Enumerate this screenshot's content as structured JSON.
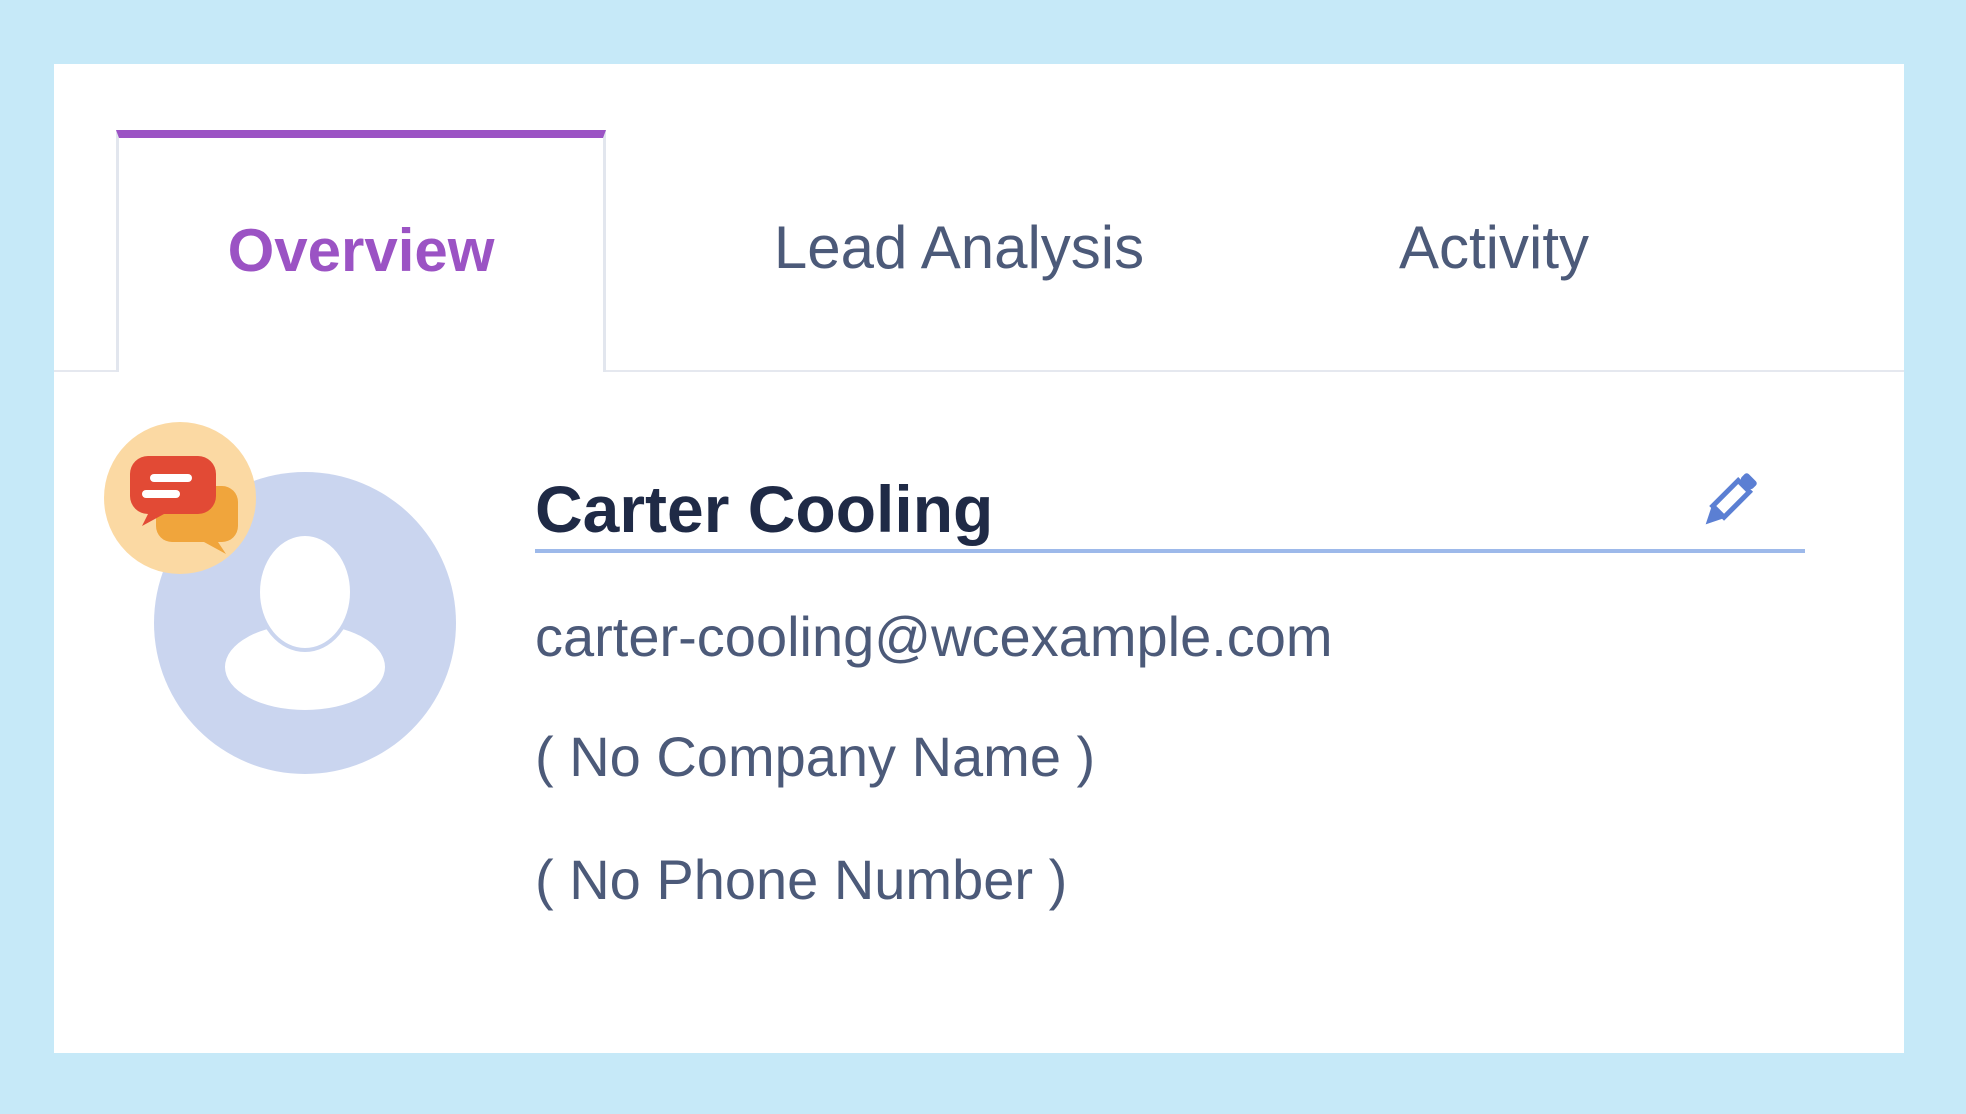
{
  "tabs": [
    {
      "label": "Overview",
      "active": true
    },
    {
      "label": "Lead Analysis",
      "active": false
    },
    {
      "label": "Activity",
      "active": false
    }
  ],
  "contact": {
    "name": "Carter Cooling",
    "email": "carter-cooling@wcexample.com",
    "company": "( No Company Name )",
    "phone": "( No Phone Number )"
  },
  "icons": {
    "avatar": "user-avatar-placeholder-icon",
    "badge": "chat-bubbles-icon",
    "edit": "pencil-icon"
  },
  "colors": {
    "page_background": "#c6e9f8",
    "card_background": "#ffffff",
    "accent_purple": "#9b53c4",
    "text_dark": "#1f2a46",
    "text_muted": "#4c5a79",
    "avatar_bg": "#cad5ef",
    "badge_bg": "#fbd9a3",
    "chat_red": "#e24a35",
    "chat_orange": "#f0a53c",
    "name_underline": "#9db9ea",
    "edit_icon": "#5b7fd3"
  }
}
